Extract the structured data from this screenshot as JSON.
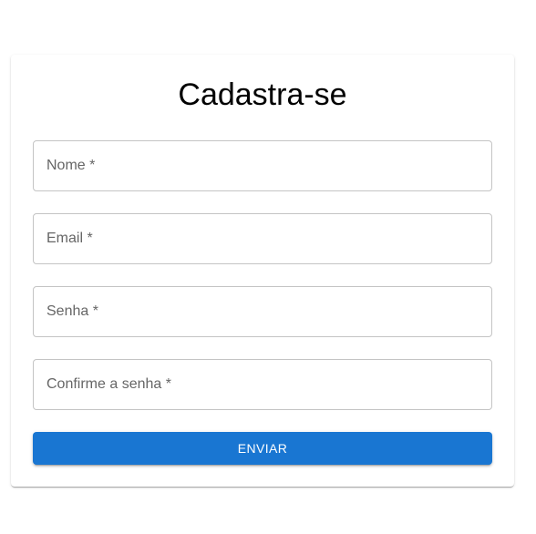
{
  "form": {
    "title": "Cadastra-se",
    "fields": [
      {
        "label": "Nome *",
        "value": ""
      },
      {
        "label": "Email *",
        "value": ""
      },
      {
        "label": "Senha *",
        "value": ""
      },
      {
        "label": "Confirme a senha *",
        "value": ""
      }
    ],
    "submit_label": "ENVIAR"
  },
  "colors": {
    "primary": "#1976d2",
    "border": "#c4c4c4",
    "label": "#666666"
  }
}
